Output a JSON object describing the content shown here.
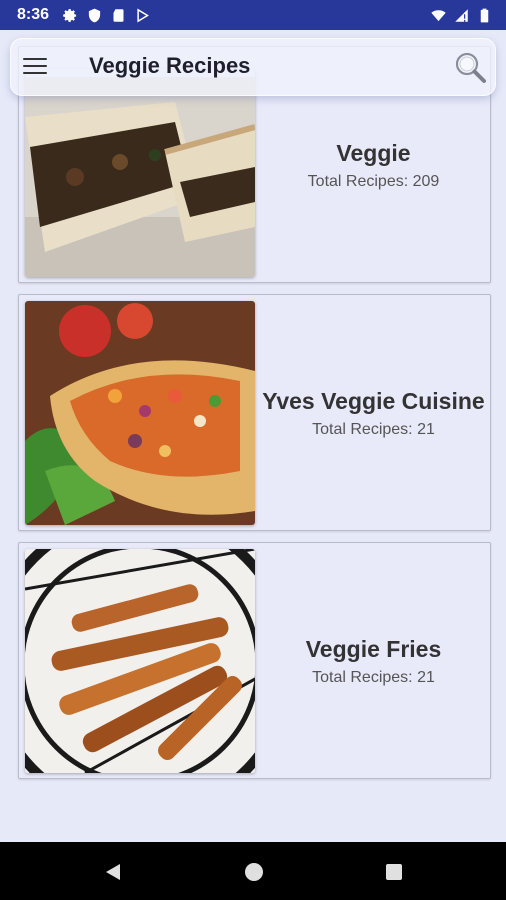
{
  "status_bar": {
    "time": "8:36",
    "icons_left": [
      "gear-icon",
      "shield-icon",
      "sd-card-icon",
      "play-store-icon"
    ],
    "icons_right": [
      "wifi-icon",
      "signal-icon",
      "battery-icon"
    ]
  },
  "app_bar": {
    "title": "Veggie Recipes",
    "menu_icon": "hamburger-menu-icon",
    "search_icon": "search-icon"
  },
  "categories": [
    {
      "title": "Veggie",
      "subtitle": "Total Recipes: 209",
      "image": "veggie-sandwich-photo"
    },
    {
      "title": "Yves Veggie Cuisine",
      "subtitle": "Total Recipes: 21",
      "image": "taco-salad-photo"
    },
    {
      "title": "Veggie Fries",
      "subtitle": "Total Recipes: 21",
      "image": "veggie-fries-photo"
    }
  ],
  "nav_bar": {
    "buttons": [
      "back-triangle-icon",
      "home-circle-icon",
      "recents-square-icon"
    ]
  },
  "colors": {
    "status_bar": "#27389a",
    "background": "#e6e9f8",
    "nav_bar": "#000000"
  }
}
